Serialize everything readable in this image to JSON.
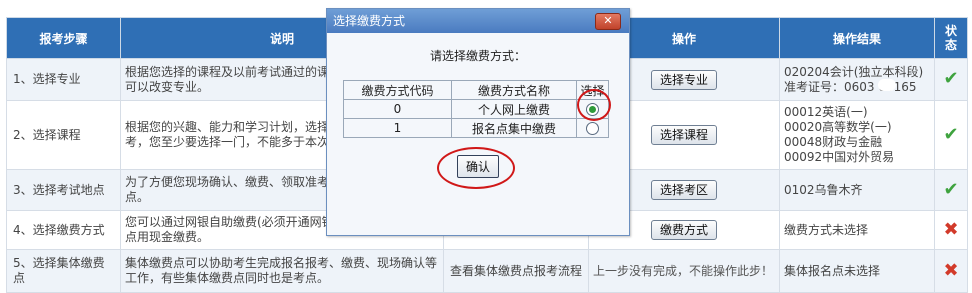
{
  "table": {
    "headers": [
      "报考步骤",
      "说明",
      "",
      "操作",
      "操作结果",
      "状态"
    ],
    "rows": [
      {
        "step": "1、选择专业",
        "desc": "根据您选择的课程及以前考试通过的课程专业，下次报考时可以改变专业。",
        "link": "",
        "button": "选择专业",
        "result": [
          "020204会计(独立本科段)",
          "准考证号：0603 00165"
        ],
        "status": "done"
      },
      {
        "step": "2、选择课程",
        "desc": "根据您的兴趣、能力和学习计划，选择课程，为了完成报考，您至少要选择一门，不能多于本次考试规定的门数。",
        "link": "",
        "button": "选择课程",
        "result": [
          "00012英语(一)",
          "00020高等数学(一)",
          "00048财政与金融",
          "00092中国对外贸易"
        ],
        "status": "done"
      },
      {
        "step": "3、选择考试地点",
        "desc": "为了方便您现场确认、缴费、领取准考证，就近选择考试地点。",
        "link": "",
        "button": "选择考区",
        "result": [
          "0102乌鲁木齐"
        ],
        "status": "done"
      },
      {
        "step": "4、选择缴费方式",
        "desc": "您可以通过网银自助缴费(必须开通网银)，可以到集体报名点用现金缴费。",
        "link": "",
        "button": "缴费方式",
        "result": [
          "缴费方式未选择"
        ],
        "status": "pending"
      },
      {
        "step": "5、选择集体缴费点",
        "desc": "集体缴费点可以协助考生完成报名报考、缴费、现场确认等工作，有些集体缴费点同时也是考点。",
        "link": "查看集体缴费点报考流程",
        "button": "上一步没有完成，不能操作此步！",
        "result": [
          "集体报名点未选择"
        ],
        "status": "pending"
      }
    ],
    "status_icons": {
      "done": "check-icon",
      "pending": "cross-icon"
    }
  },
  "dialog": {
    "title": "选择缴费方式",
    "close_label": "✕",
    "prompt": "请选择缴费方式：",
    "columns": [
      "缴费方式代码",
      "缴费方式名称",
      "选择"
    ],
    "options": [
      {
        "code": "0",
        "name": "个人网上缴费",
        "selected": true
      },
      {
        "code": "1",
        "name": "报名点集中缴费",
        "selected": false
      }
    ],
    "confirm_label": "确认"
  },
  "colors": {
    "header_bg": "#2f6fb5",
    "annotation": "#d01818",
    "check": "#3fa33f",
    "cross": "#d23a2a"
  }
}
